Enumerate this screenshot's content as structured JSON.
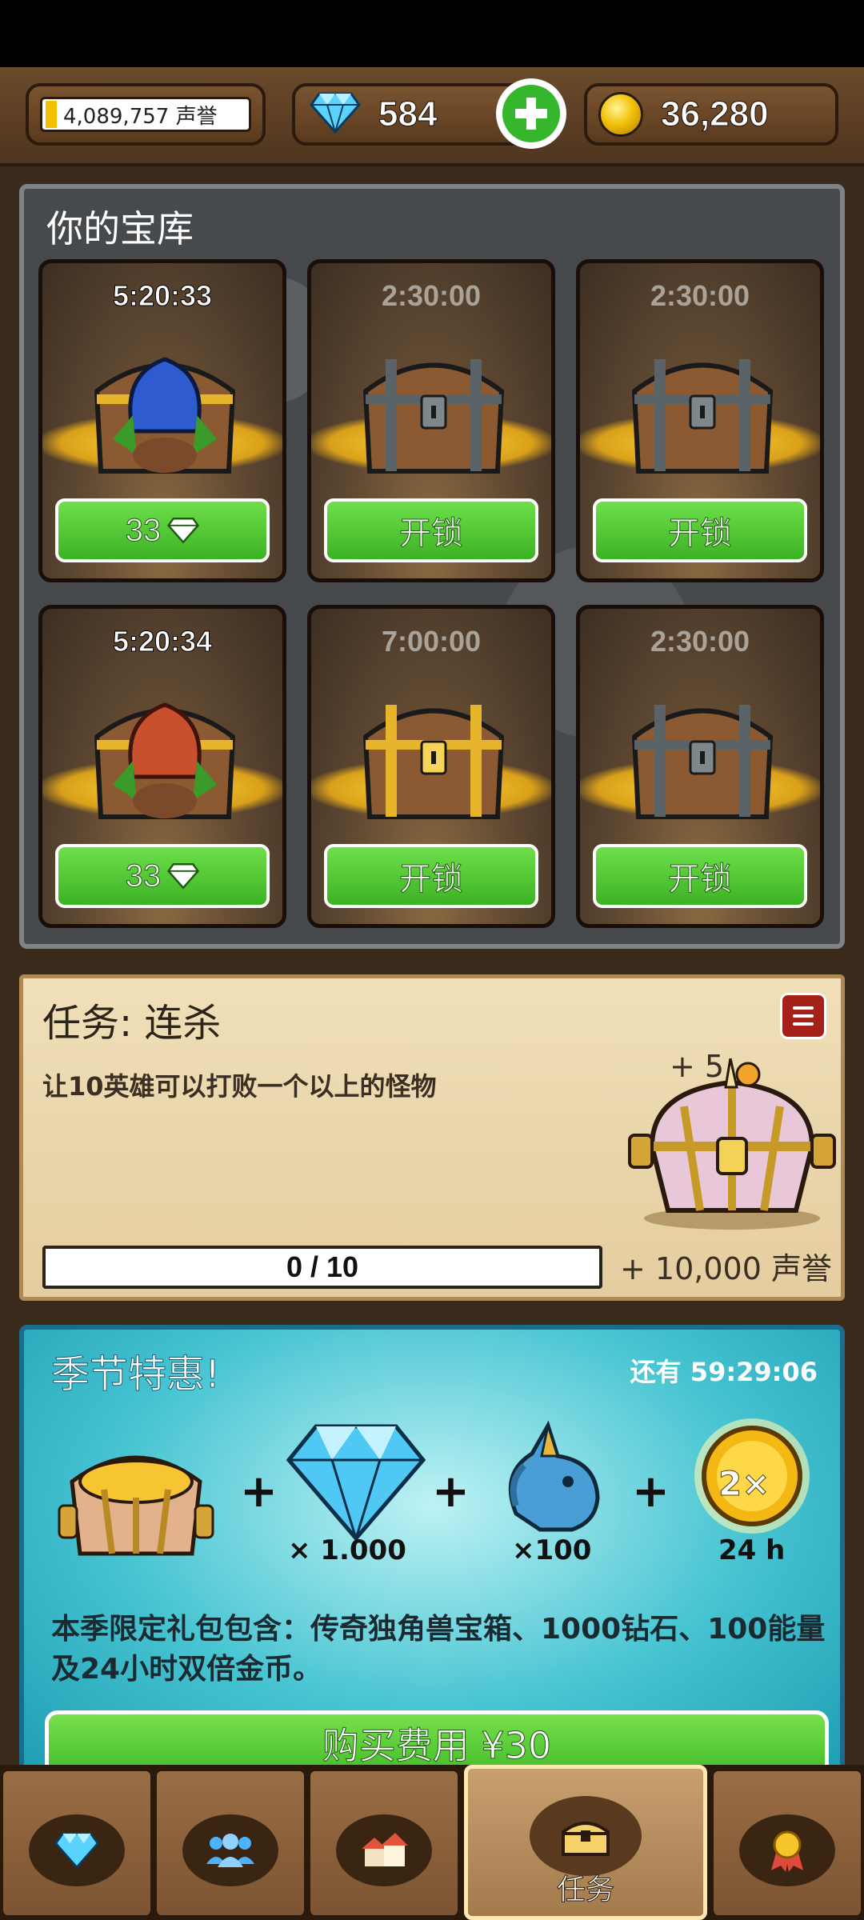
{
  "resources": {
    "reputation_text": "4,089,757 声誉",
    "gems": "584",
    "coins": "36,280"
  },
  "vault": {
    "title": "你的宝库",
    "slots": [
      {
        "timer": "5:20:33",
        "button": "33",
        "state": "active",
        "chest": "blue-unicorn-chest"
      },
      {
        "timer": "2:30:00",
        "button": "开锁",
        "state": "locked",
        "chest": "silver-chest"
      },
      {
        "timer": "2:30:00",
        "button": "开锁",
        "state": "locked",
        "chest": "silver-chest"
      },
      {
        "timer": "5:20:34",
        "button": "33",
        "state": "active",
        "chest": "red-unicorn-chest"
      },
      {
        "timer": "7:00:00",
        "button": "开锁",
        "state": "locked",
        "chest": "gold-chest"
      },
      {
        "timer": "2:30:00",
        "button": "开锁",
        "state": "locked",
        "chest": "silver-chest"
      }
    ]
  },
  "quest": {
    "title": "任务: 连杀",
    "description": "让10英雄可以打败一个以上的怪物",
    "bonus": "+ 5",
    "progress_text": "0 / 10",
    "progress_fraction": 0,
    "reward": "+ 10,000 声誉"
  },
  "offer": {
    "title": "季节特惠!",
    "timer": "还有 59:29:06",
    "items": [
      {
        "icon": "legendary-chest-icon",
        "label": ""
      },
      {
        "icon": "diamond-icon",
        "label": "× 1.000"
      },
      {
        "icon": "unicorn-energy-icon",
        "label": "×100"
      },
      {
        "icon": "double-coin-icon",
        "label": "24 h"
      }
    ],
    "multiplier": "2×",
    "description": "本季限定礼包包含：传奇独角兽宝箱、1000钻石、100能量及24小时双倍金币。",
    "buy_label": "购买费用 ¥30"
  },
  "nav": {
    "tabs": [
      {
        "name": "shop",
        "icon": "diamond-icon",
        "label": ""
      },
      {
        "name": "heroes",
        "icon": "people-icon",
        "label": ""
      },
      {
        "name": "town",
        "icon": "houses-icon",
        "label": ""
      },
      {
        "name": "quests",
        "icon": "chest-icon",
        "label": "任务"
      },
      {
        "name": "achievements",
        "icon": "medal-icon",
        "label": ""
      }
    ]
  },
  "colors": {
    "button_green": "#3bb324",
    "wood": "#6b4a2b",
    "offer_teal": "#47c4d2"
  }
}
